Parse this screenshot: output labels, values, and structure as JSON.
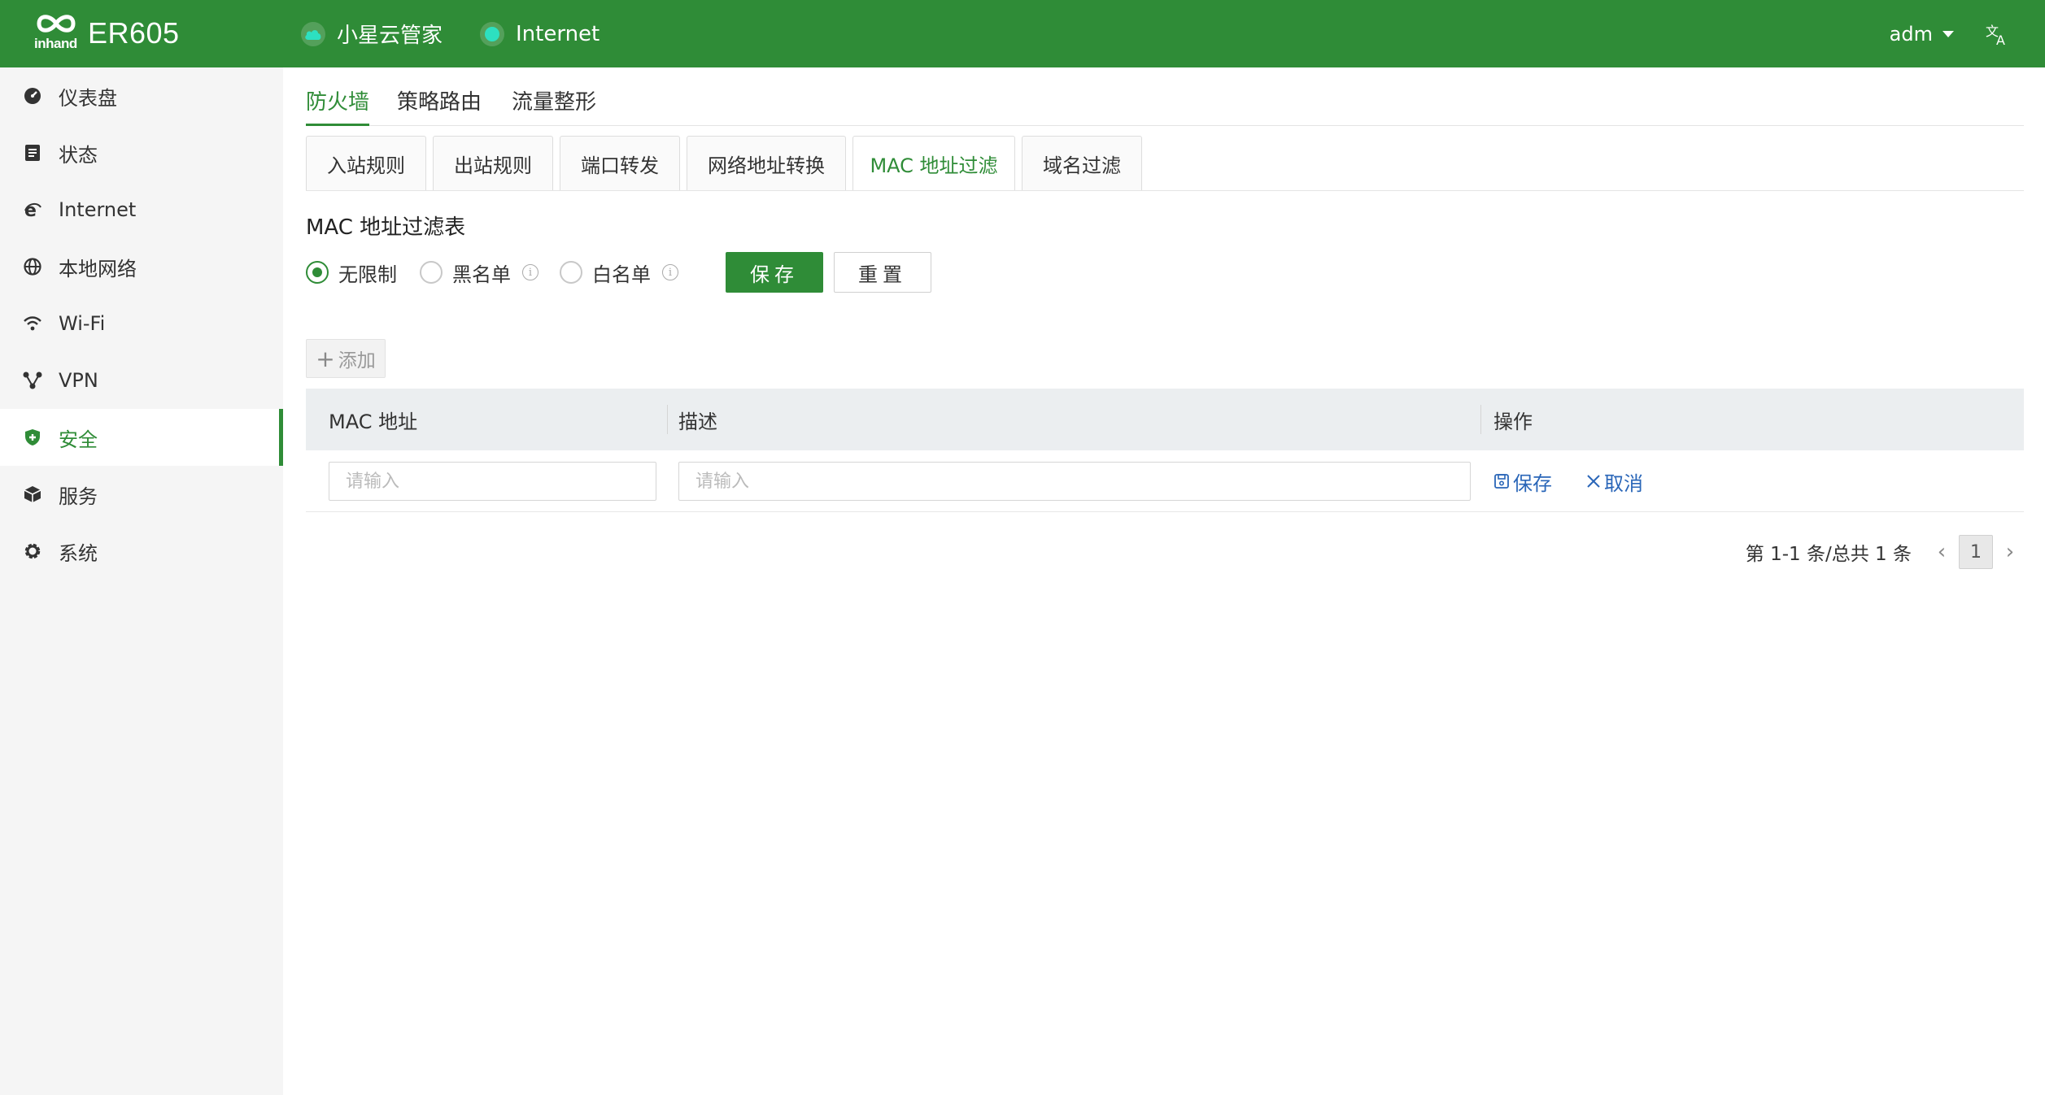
{
  "header": {
    "logo_word": "inhand",
    "model": "ER605",
    "cloud_label": "小星云管家",
    "internet_label": "Internet",
    "user": "adm",
    "lang_icon": "translate-icon"
  },
  "sidebar": {
    "items": [
      {
        "label": "仪表盘",
        "icon": "dashboard-icon"
      },
      {
        "label": "状态",
        "icon": "status-icon"
      },
      {
        "label": "Internet",
        "icon": "internet-icon"
      },
      {
        "label": "本地网络",
        "icon": "globe-icon"
      },
      {
        "label": "Wi-Fi",
        "icon": "wifi-icon"
      },
      {
        "label": "VPN",
        "icon": "vpn-icon"
      },
      {
        "label": "安全",
        "icon": "shield-icon",
        "active": true
      },
      {
        "label": "服务",
        "icon": "cube-icon"
      },
      {
        "label": "系统",
        "icon": "gear-icon"
      }
    ]
  },
  "main": {
    "tabs": [
      {
        "label": "防火墙",
        "active": true
      },
      {
        "label": "策略路由"
      },
      {
        "label": "流量整形"
      }
    ],
    "subtabs": [
      {
        "label": "入站规则"
      },
      {
        "label": "出站规则"
      },
      {
        "label": "端口转发"
      },
      {
        "label": "网络地址转换"
      },
      {
        "label": "MAC 地址过滤",
        "active": true
      },
      {
        "label": "域名过滤"
      }
    ],
    "section_title": "MAC 地址过滤表",
    "radios": [
      {
        "label": "无限制",
        "checked": true
      },
      {
        "label": "黑名单"
      },
      {
        "label": "白名单"
      }
    ],
    "save_label": "保存",
    "reset_label": "重置",
    "add_label": "添加",
    "table": {
      "columns": [
        "MAC 地址",
        "描述",
        "操作"
      ],
      "mac_placeholder": "请输入",
      "desc_placeholder": "请输入",
      "row_save": "保存",
      "row_cancel": "取消"
    },
    "pagination": {
      "summary": "第 1-1 条/总共 1 条",
      "current_page": "1"
    }
  },
  "colors": {
    "brand": "#2f8c37",
    "link": "#2a66b8",
    "status_dot": "#2de0c0"
  }
}
